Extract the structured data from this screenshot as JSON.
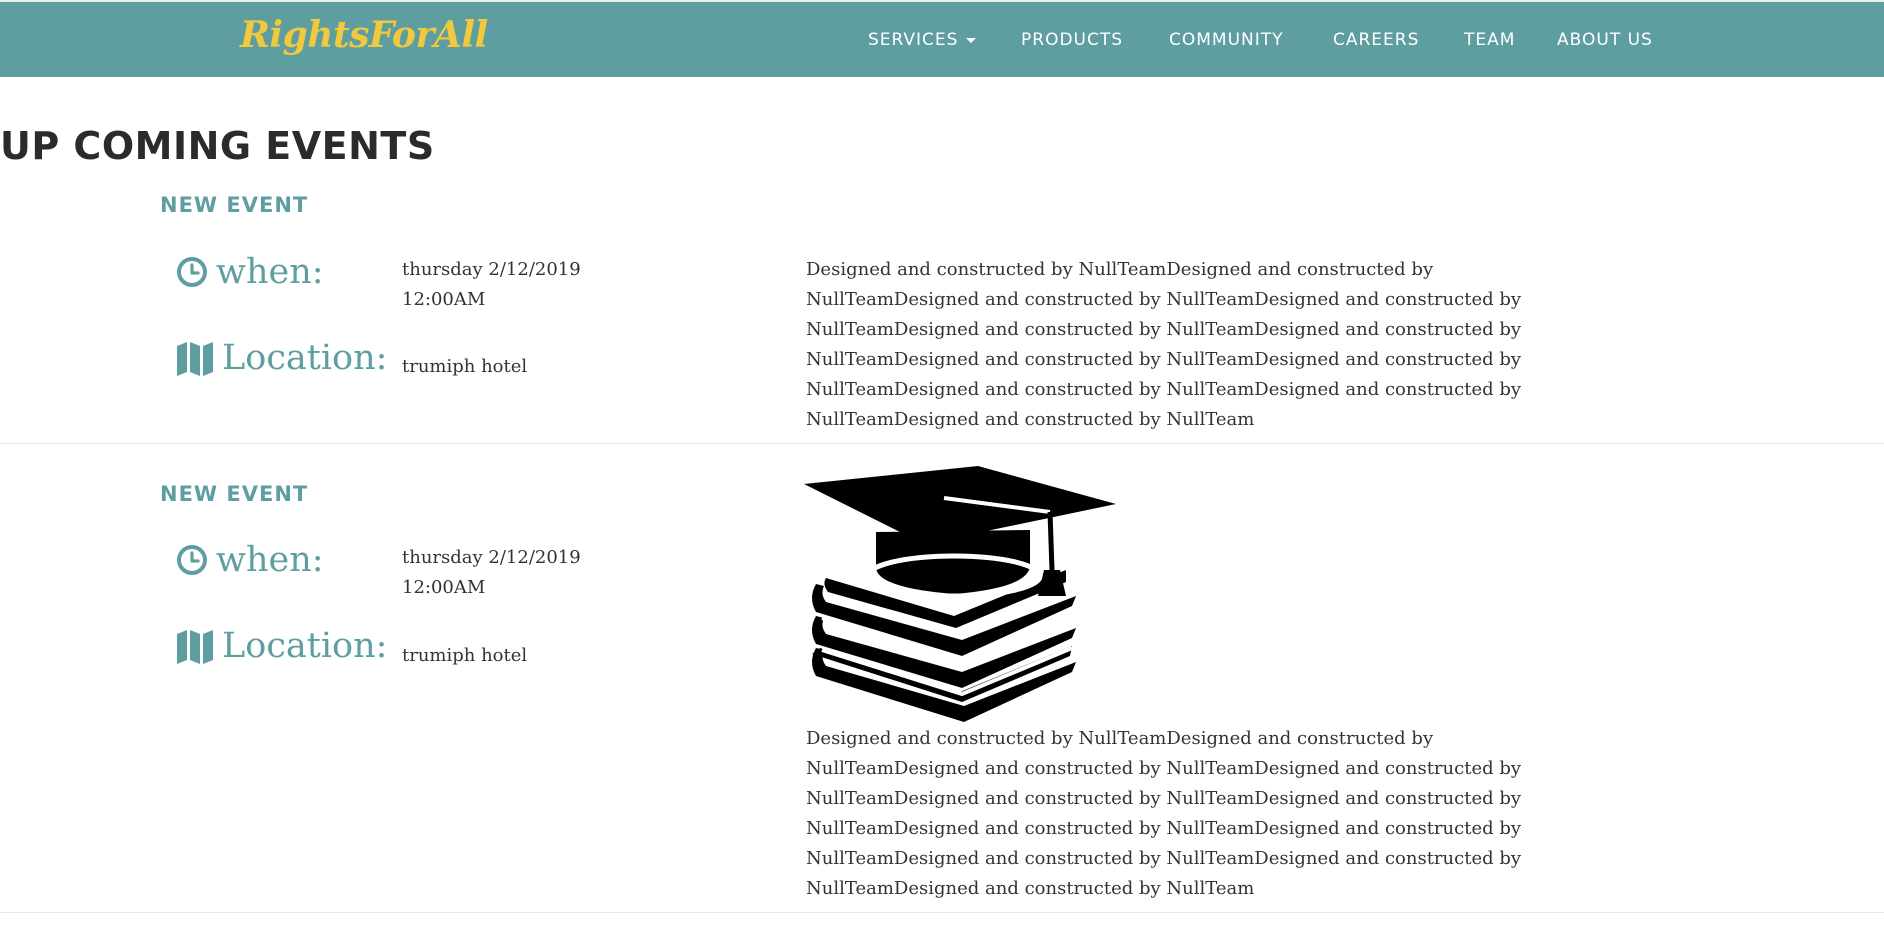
{
  "brand": {
    "name": "RightsForAll",
    "color": "#f0c93c"
  },
  "theme": {
    "navbar_bg": "#5f9ea0",
    "accent": "#5f9ea0"
  },
  "nav": {
    "services": "SERVICES",
    "products": "PRODUCTS",
    "community": "COMMUNITY",
    "careers": "CAREERS",
    "team": "TEAM",
    "about": "ABOUT US"
  },
  "section_title": "UP COMING EVENTS",
  "events": [
    {
      "title": "NEW EVENT",
      "when_label": "when:",
      "date": "thursday 2/12/2019",
      "time": "12:00AM",
      "location_label": "Location:",
      "location": "trumiph hotel",
      "description": "Designed and constructed by NullTeamDesigned and constructed by NullTeamDesigned and constructed by NullTeamDesigned and constructed by NullTeamDesigned and constructed by NullTeamDesigned and constructed by NullTeamDesigned and constructed by NullTeamDesigned and constructed by NullTeamDesigned and constructed by NullTeamDesigned and constructed by NullTeamDesigned and constructed by NullTeam"
    },
    {
      "title": "NEW EVENT",
      "when_label": "when:",
      "date": "thursday 2/12/2019",
      "time": "12:00AM",
      "location_label": "Location:",
      "location": "trumiph hotel",
      "image_icon": "graduation-cap-books-icon",
      "description": "Designed and constructed by NullTeamDesigned and constructed by NullTeamDesigned and constructed by NullTeamDesigned and constructed by NullTeamDesigned and constructed by NullTeamDesigned and constructed by NullTeamDesigned and constructed by NullTeamDesigned and constructed by NullTeamDesigned and constructed by NullTeamDesigned and constructed by NullTeamDesigned and constructed by NullTeam"
    }
  ],
  "icons": {
    "when": "clock-icon",
    "location": "map-icon"
  }
}
